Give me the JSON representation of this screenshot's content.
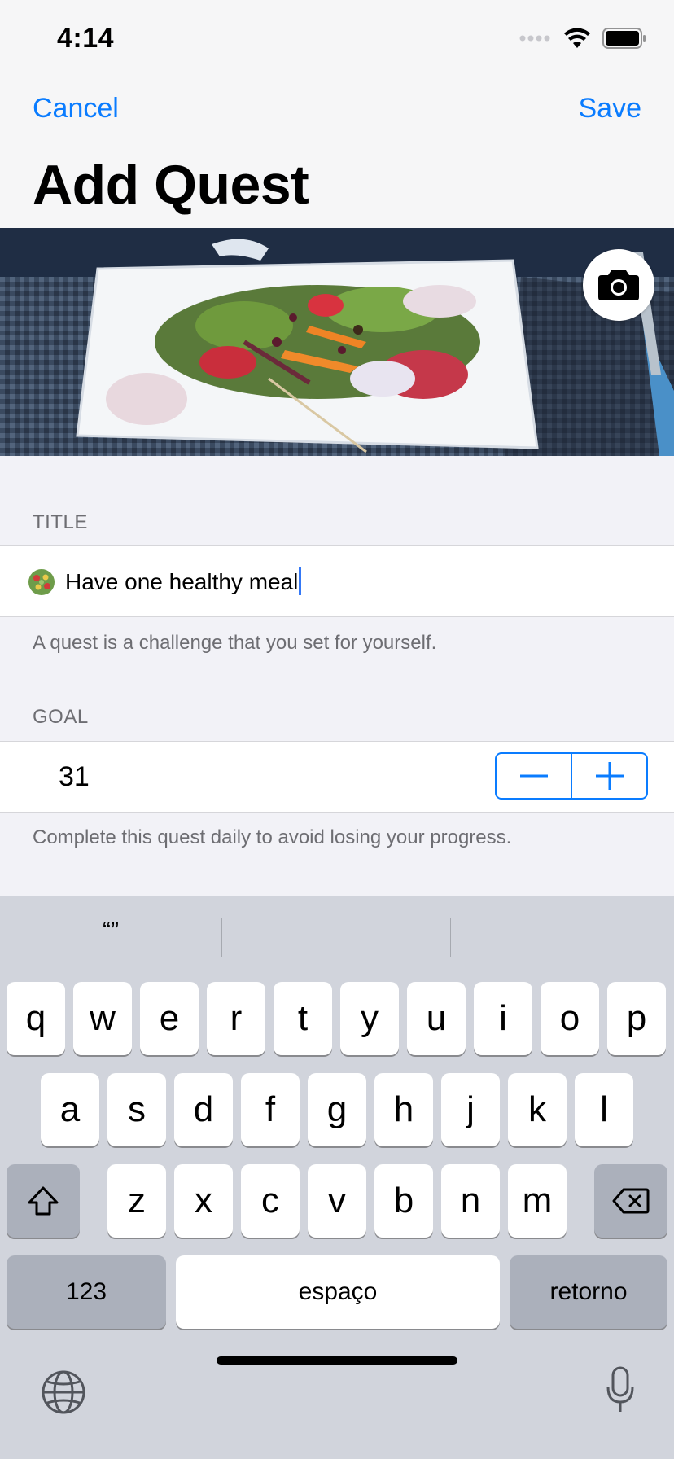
{
  "status_bar": {
    "time": "4:14"
  },
  "nav": {
    "cancel_label": "Cancel",
    "save_label": "Save",
    "title": "Add Quest"
  },
  "title_section": {
    "header": "TITLE",
    "value": "Have one healthy meal",
    "footer": "A quest is a challenge that you set for yourself."
  },
  "goal_section": {
    "header": "GOAL",
    "value": "31",
    "footer": "Complete this quest daily to avoid losing your progress."
  },
  "keyboard": {
    "predictions": [
      "“”",
      "",
      ""
    ],
    "row1": [
      "q",
      "w",
      "e",
      "r",
      "t",
      "y",
      "u",
      "i",
      "o",
      "p"
    ],
    "row2": [
      "a",
      "s",
      "d",
      "f",
      "g",
      "h",
      "j",
      "k",
      "l"
    ],
    "row3": [
      "z",
      "x",
      "c",
      "v",
      "b",
      "n",
      "m"
    ],
    "numbers_label": "123",
    "space_label": "espaço",
    "return_label": "retorno"
  },
  "colors": {
    "accent": "#0a7cff",
    "caret": "#3478f6",
    "keyboard_bg": "#d1d4dc"
  },
  "icons": [
    "wifi-icon",
    "battery-icon",
    "signal-icon",
    "camera-icon",
    "minus-icon",
    "plus-icon",
    "shift-icon",
    "backspace-icon",
    "globe-icon",
    "microphone-icon"
  ]
}
